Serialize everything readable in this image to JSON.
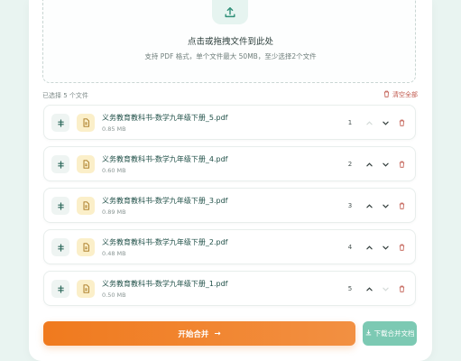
{
  "dropzone": {
    "icon": "upload-icon",
    "title": "点击或拖拽文件到此处",
    "hint": "支持 PDF 格式，单个文件最大 50MB，至少选择2个文件"
  },
  "list": {
    "selected_label": "已选择 5 个文件",
    "clear_label": "清空全部",
    "files": [
      {
        "name": "义务教育教科书-数学九年级下册_5.pdf",
        "size": "0.85 MB",
        "order": "1"
      },
      {
        "name": "义务教育教科书-数学九年级下册_4.pdf",
        "size": "0.60 MB",
        "order": "2"
      },
      {
        "name": "义务教育教科书-数学九年级下册_3.pdf",
        "size": "0.89 MB",
        "order": "3"
      },
      {
        "name": "义务教育教科书-数学九年级下册_2.pdf",
        "size": "0.48 MB",
        "order": "4"
      },
      {
        "name": "义务教育教科书-数学九年级下册_1.pdf",
        "size": "0.50 MB",
        "order": "5"
      }
    ]
  },
  "actions": {
    "merge_label": "开始合并",
    "merge_arrow": "→",
    "download_label": "下载合并文档"
  },
  "colors": {
    "accent_orange": "#f07a1e",
    "accent_green": "#6ec4ab",
    "delete_red": "#c0584c"
  }
}
